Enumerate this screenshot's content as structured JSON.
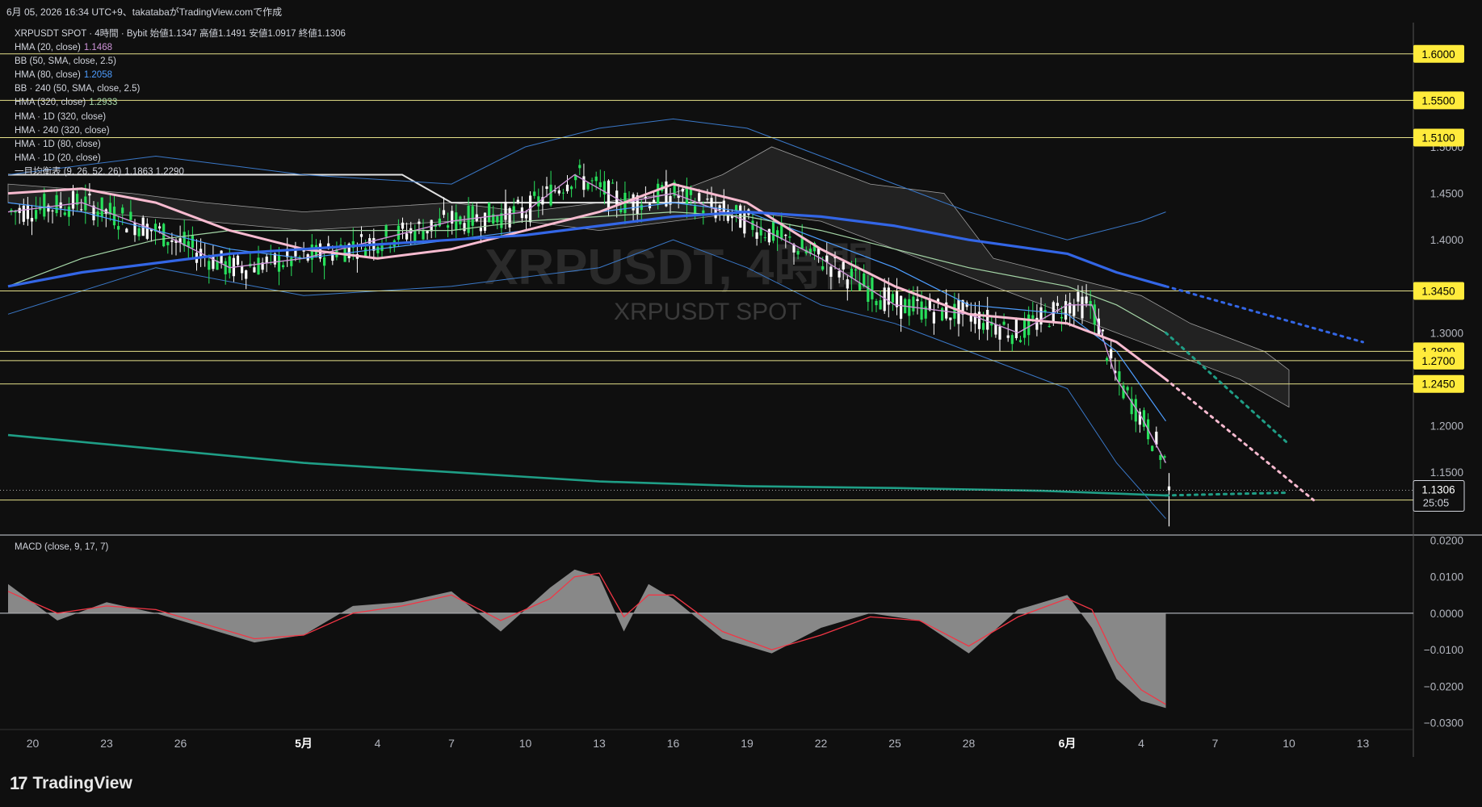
{
  "header": {
    "attribution": "6月 05, 2026 16:34 UTC+9、takatabaがTradingView.comで作成",
    "symbol_line": "XRPUSDT SPOT · 4時間 · Bybit  始値1.1347  高値1.1491  安値1.0917  終値1.1306"
  },
  "legend": [
    {
      "label": "HMA (20, close)",
      "value": "1.1468",
      "color": "#ce93d8"
    },
    {
      "label": "BB (50, SMA, close, 2.5)",
      "value": "",
      "color": "#d1d4dc"
    },
    {
      "label": "HMA (80, close)",
      "value": "1.2058",
      "color": "#4d9dff"
    },
    {
      "label": "BB · 240 (50, SMA, close, 2.5)",
      "value": "",
      "color": "#d1d4dc"
    },
    {
      "label": "HMA (320, close)",
      "value": "1.2933",
      "color": "#a5d6a7"
    },
    {
      "label": "HMA · 1D (320, close)",
      "value": "",
      "color": "#d1d4dc"
    },
    {
      "label": "HMA · 240 (320, close)",
      "value": "",
      "color": "#d1d4dc"
    },
    {
      "label": "HMA · 1D (80, close)",
      "value": "",
      "color": "#d1d4dc"
    },
    {
      "label": "HMA · 1D (20, close)",
      "value": "",
      "color": "#d1d4dc"
    },
    {
      "label": "一目均衡表 (9, 26, 52, 26)",
      "value": "1.1863  1.2290",
      "color": "#d1d4dc"
    }
  ],
  "watermark": {
    "big": "XRPUSDT, 4時間",
    "small": "XRPUSDT SPOT"
  },
  "macd_label": "MACD (close, 9, 17, 7)",
  "brand": {
    "logo": "17",
    "name": "TradingView"
  },
  "colors": {
    "background": "#0f0f0f",
    "level_line": "#e6e08a",
    "level_label_bg": "#ffeb3b",
    "hma20": "#ce93d8",
    "hma80": "#4d9dff",
    "hma320": "#a5d6a7",
    "hma1d80": "#f8bbd0",
    "hma1d320": "#3366e6",
    "hma240_320": "#1f9e86",
    "bb": "#3a78c8",
    "ichimoku": "#9e9e9e",
    "candle_up": "#27e05b",
    "candle_down": "#ffffff",
    "macd_hist": "#9e9e9e",
    "macd_signal": "#f23645"
  },
  "chart_data": [
    {
      "type": "line",
      "title": "XRPUSDT SPOT · 4時間 · Bybit",
      "price_axis": {
        "range": [
          1.085,
          1.625
        ],
        "tick_labels": [
          "1.5000",
          "1.4500",
          "1.4000",
          "1.3000",
          "1.2000",
          "1.1500"
        ]
      },
      "horizontal_levels": [
        "1.6000",
        "1.5500",
        "1.5100",
        "1.3450",
        "1.2800",
        "1.2700",
        "1.2450",
        "1.1200"
      ],
      "last_price": {
        "value": "1.1306",
        "countdown": "25:05"
      },
      "ohlc": {
        "open": 1.1347,
        "high": 1.1491,
        "low": 1.0917,
        "close": 1.1306
      },
      "x_axis": {
        "tick_labels": [
          "20",
          "23",
          "26",
          "5月",
          "4",
          "7",
          "10",
          "13",
          "16",
          "19",
          "22",
          "25",
          "28",
          "6月",
          "4",
          "7",
          "10",
          "13"
        ],
        "month_labels": [
          "5月",
          "6月"
        ]
      },
      "series": [
        {
          "name": "HMA (20, close)",
          "last_value": 1.1468,
          "x": [
            "4/19",
            "4/22",
            "4/25",
            "4/28",
            "5/1",
            "5/4",
            "5/7",
            "5/10",
            "5/12",
            "5/14",
            "5/16",
            "5/19",
            "5/22",
            "5/25",
            "5/28",
            "5/30",
            "6/1",
            "6/2",
            "6/3",
            "6/4",
            "6/5"
          ],
          "values": [
            1.43,
            1.44,
            1.41,
            1.37,
            1.38,
            1.4,
            1.42,
            1.43,
            1.47,
            1.44,
            1.45,
            1.42,
            1.38,
            1.33,
            1.32,
            1.3,
            1.33,
            1.33,
            1.25,
            1.21,
            1.16
          ]
        },
        {
          "name": "HMA (80, close)",
          "last_value": 1.2058,
          "x": [
            "4/19",
            "4/22",
            "4/25",
            "4/28",
            "5/1",
            "5/4",
            "5/7",
            "5/10",
            "5/13",
            "5/16",
            "5/19",
            "5/22",
            "5/25",
            "5/28",
            "6/1",
            "6/3",
            "6/5"
          ],
          "values": [
            1.44,
            1.43,
            1.41,
            1.39,
            1.38,
            1.39,
            1.4,
            1.41,
            1.43,
            1.44,
            1.43,
            1.4,
            1.37,
            1.33,
            1.32,
            1.28,
            1.205
          ]
        },
        {
          "name": "HMA (320, close)",
          "last_value": 1.2933,
          "x": [
            "4/19",
            "4/22",
            "4/25",
            "4/28",
            "5/1",
            "5/4",
            "5/7",
            "5/10",
            "5/13",
            "5/16",
            "5/19",
            "5/22",
            "5/25",
            "5/28",
            "6/1",
            "6/3",
            "6/5"
          ],
          "values": [
            1.35,
            1.38,
            1.4,
            1.41,
            1.41,
            1.41,
            1.41,
            1.42,
            1.425,
            1.43,
            1.425,
            1.41,
            1.39,
            1.37,
            1.35,
            1.33,
            1.3
          ]
        },
        {
          "name": "HMA · 1D (80, close)",
          "x": [
            "4/19",
            "4/22",
            "4/25",
            "4/28",
            "5/1",
            "5/4",
            "5/7",
            "5/10",
            "5/13",
            "5/16",
            "5/19",
            "5/22",
            "5/25",
            "5/28",
            "6/1",
            "6/3",
            "6/5"
          ],
          "values": [
            1.45,
            1.455,
            1.44,
            1.41,
            1.39,
            1.38,
            1.39,
            1.41,
            1.43,
            1.46,
            1.44,
            1.39,
            1.35,
            1.32,
            1.31,
            1.29,
            1.25
          ]
        },
        {
          "name": "HMA · 1D (320, close)",
          "x": [
            "4/19",
            "4/22",
            "4/25",
            "4/28",
            "5/1",
            "5/4",
            "5/7",
            "5/10",
            "5/13",
            "5/16",
            "5/19",
            "5/22",
            "5/25",
            "5/28",
            "6/1",
            "6/3",
            "6/5"
          ],
          "values": [
            1.35,
            1.365,
            1.375,
            1.385,
            1.39,
            1.395,
            1.4,
            1.405,
            1.415,
            1.425,
            1.43,
            1.425,
            1.415,
            1.4,
            1.385,
            1.365,
            1.35
          ]
        },
        {
          "name": "HMA · 240 (320, close)",
          "x": [
            "4/19",
            "4/25",
            "5/1",
            "5/7",
            "5/13",
            "5/19",
            "5/25",
            "5/31",
            "6/5"
          ],
          "values": [
            1.19,
            1.175,
            1.16,
            1.15,
            1.14,
            1.135,
            1.133,
            1.13,
            1.125
          ]
        }
      ]
    },
    {
      "type": "bar",
      "title": "MACD (close, 9, 17, 7)",
      "y_axis": {
        "range": [
          -0.031,
          0.021
        ],
        "tick_labels": [
          "0.0200",
          "0.0100",
          "0.0000",
          "−0.0100",
          "−0.0200",
          "−0.0300"
        ]
      },
      "x": [
        "4/19",
        "4/21",
        "4/23",
        "4/25",
        "4/27",
        "4/29",
        "5/1",
        "5/3",
        "5/5",
        "5/7",
        "5/9",
        "5/11",
        "5/12",
        "5/13",
        "5/14",
        "5/15",
        "5/16",
        "5/18",
        "5/20",
        "5/22",
        "5/24",
        "5/26",
        "5/28",
        "5/30",
        "6/1",
        "6/2",
        "6/3",
        "6/4",
        "6/5"
      ],
      "series": [
        {
          "name": "MACD",
          "values": [
            0.008,
            -0.002,
            0.003,
            0.0,
            -0.004,
            -0.008,
            -0.006,
            0.002,
            0.003,
            0.006,
            -0.005,
            0.007,
            0.012,
            0.01,
            -0.005,
            0.008,
            0.004,
            -0.007,
            -0.011,
            -0.004,
            0.0,
            -0.002,
            -0.011,
            0.001,
            0.005,
            -0.004,
            -0.018,
            -0.024,
            -0.026
          ]
        },
        {
          "name": "Signal",
          "values": [
            0.006,
            0.0,
            0.002,
            0.001,
            -0.003,
            -0.007,
            -0.006,
            0.0,
            0.002,
            0.005,
            -0.002,
            0.004,
            0.01,
            0.011,
            -0.001,
            0.005,
            0.005,
            -0.005,
            -0.01,
            -0.006,
            -0.001,
            -0.002,
            -0.009,
            -0.001,
            0.004,
            0.001,
            -0.013,
            -0.021,
            -0.025
          ]
        }
      ]
    }
  ]
}
